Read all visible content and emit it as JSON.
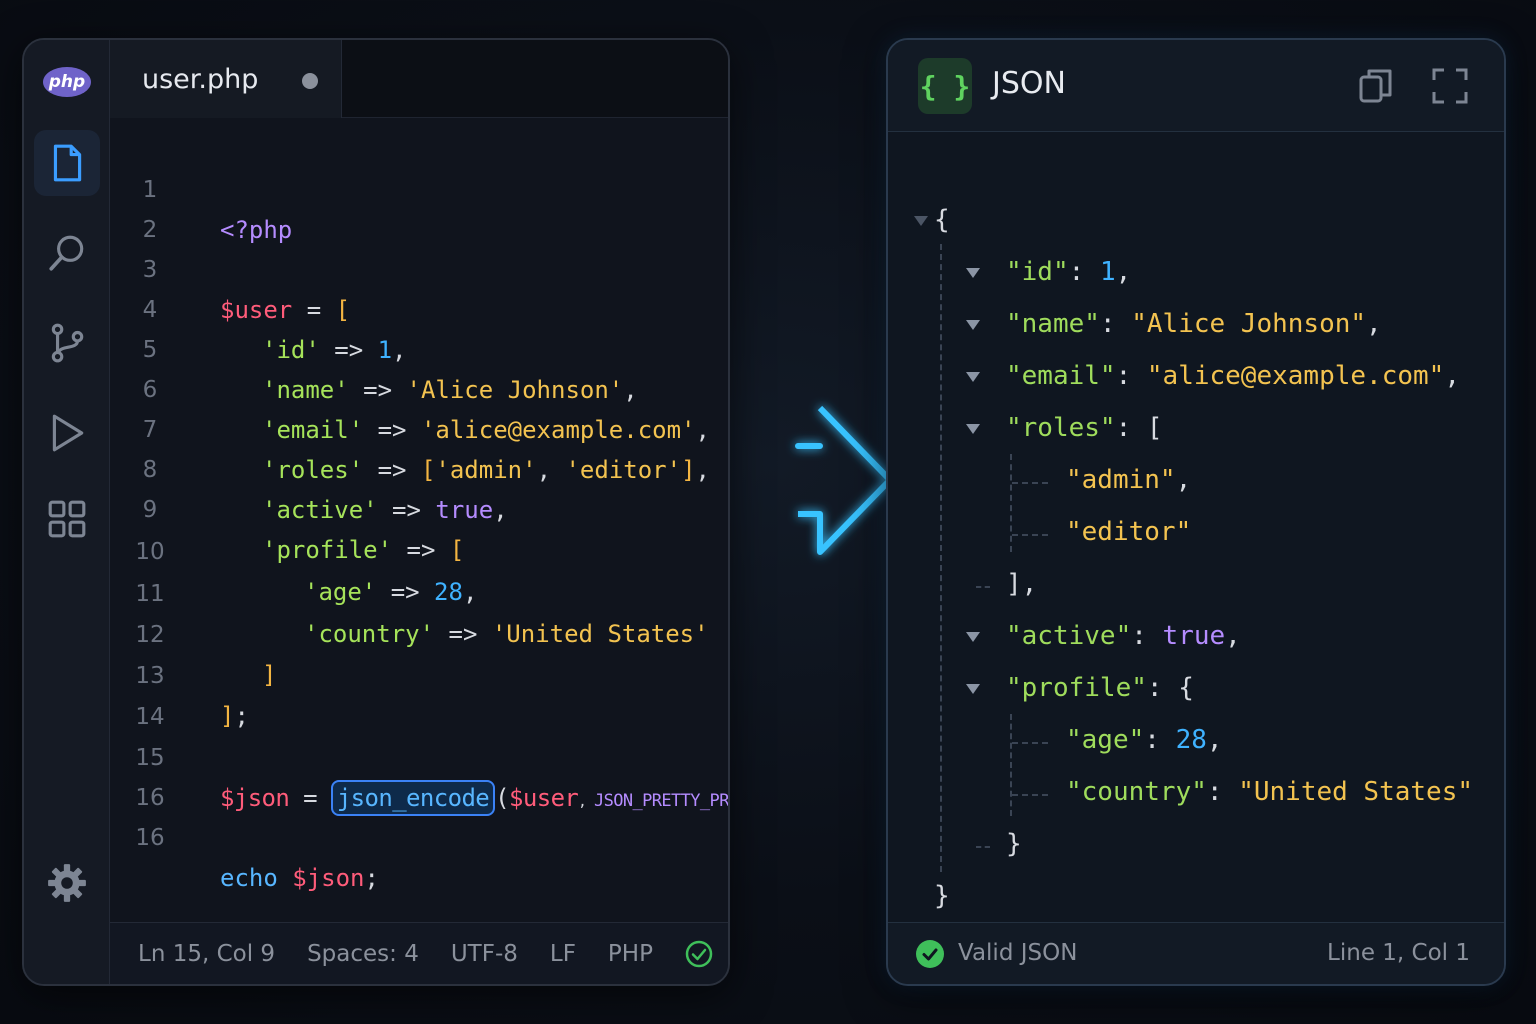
{
  "editor": {
    "logo_text": "php",
    "tab": {
      "filename": "user.php",
      "modified": true
    },
    "activity_bar": [
      {
        "name": "explorer",
        "icon": "file-icon",
        "active": true
      },
      {
        "name": "search",
        "icon": "search-icon",
        "active": false
      },
      {
        "name": "source-control",
        "icon": "git-branch-icon",
        "active": false
      },
      {
        "name": "run",
        "icon": "play-icon",
        "active": false
      },
      {
        "name": "extensions",
        "icon": "grid-icon",
        "active": false
      },
      {
        "name": "settings",
        "icon": "gear-icon",
        "active": false
      }
    ],
    "line_numbers": [
      "1",
      "2",
      "3",
      "4",
      "5",
      "6",
      "7",
      "8",
      "9",
      "10",
      "11",
      "12",
      "13",
      "14",
      "15",
      "16",
      "16"
    ],
    "code": {
      "l1": "<?php",
      "l3_var": "$user",
      "l3_op": " = ",
      "l3_br": "[",
      "l4_key": "'id'",
      "l4_op": " => ",
      "l4_val": "1",
      "l4_end": ",",
      "l5_key": "'name'",
      "l5_op": " => ",
      "l5_val": "'Alice Johnson'",
      "l5_end": ",",
      "l6_key": "'email'",
      "l6_op": " => ",
      "l6_val": "'alice@example.com'",
      "l6_end": ",",
      "l7_key": "'roles'",
      "l7_op": " => ",
      "l7_br1": "[",
      "l7_v1": "'admin'",
      "l7_sep": ", ",
      "l7_v2": "'editor'",
      "l7_br2": "]",
      "l7_end": ",",
      "l8_key": "'active'",
      "l8_op": " => ",
      "l8_val": "true",
      "l8_end": ",",
      "l9_key": "'profile'",
      "l9_op": " => ",
      "l9_br": "[",
      "l10_key": "'age'",
      "l10_op": " => ",
      "l10_val": "28",
      "l10_end": ",",
      "l11_key": "'country'",
      "l11_op": " => ",
      "l11_val": "'United States'",
      "l12_br": "]",
      "l13_br": "]",
      "l13_end": ";",
      "l15_var": "$json",
      "l15_op": " = ",
      "l15_fn": "json_encode",
      "l15_p1": "(",
      "l15_arg": "$user",
      "l15_comma": ", ",
      "l15_const": "JSON_PRETTY_PRINT",
      "l15_p2": ");",
      "l16_kw": "echo",
      "l16_var": " $json",
      "l16_end": ";"
    },
    "status": {
      "position": "Ln 15, Col 9",
      "spaces": "Spaces: 4",
      "encoding": "UTF-8",
      "eol": "LF",
      "language": "PHP"
    }
  },
  "json_panel": {
    "badge": "{ }",
    "title": "JSON",
    "lines": {
      "open": "{",
      "id_key": "\"id\"",
      "id_val": "1",
      "name_key": "\"name\"",
      "name_val": "\"Alice Johnson\"",
      "email_key": "\"email\"",
      "email_val": "\"alice@example.com\"",
      "roles_key": "\"roles\"",
      "roles_open": "[",
      "role1": "\"admin\"",
      "role2": "\"editor\"",
      "roles_close": "],",
      "active_key": "\"active\"",
      "active_val": "true",
      "profile_key": "\"profile\"",
      "profile_open": "{",
      "age_key": "\"age\"",
      "age_val": "28",
      "country_key": "\"country\"",
      "country_val": "\"United States\"",
      "profile_close": "}",
      "close": "}"
    },
    "status": {
      "valid": "Valid JSON",
      "position": "Line 1, Col 1"
    }
  },
  "colors": {
    "accent": "#3b82f6",
    "valid": "#3fbf5a",
    "arrow": "#39c3ff"
  }
}
